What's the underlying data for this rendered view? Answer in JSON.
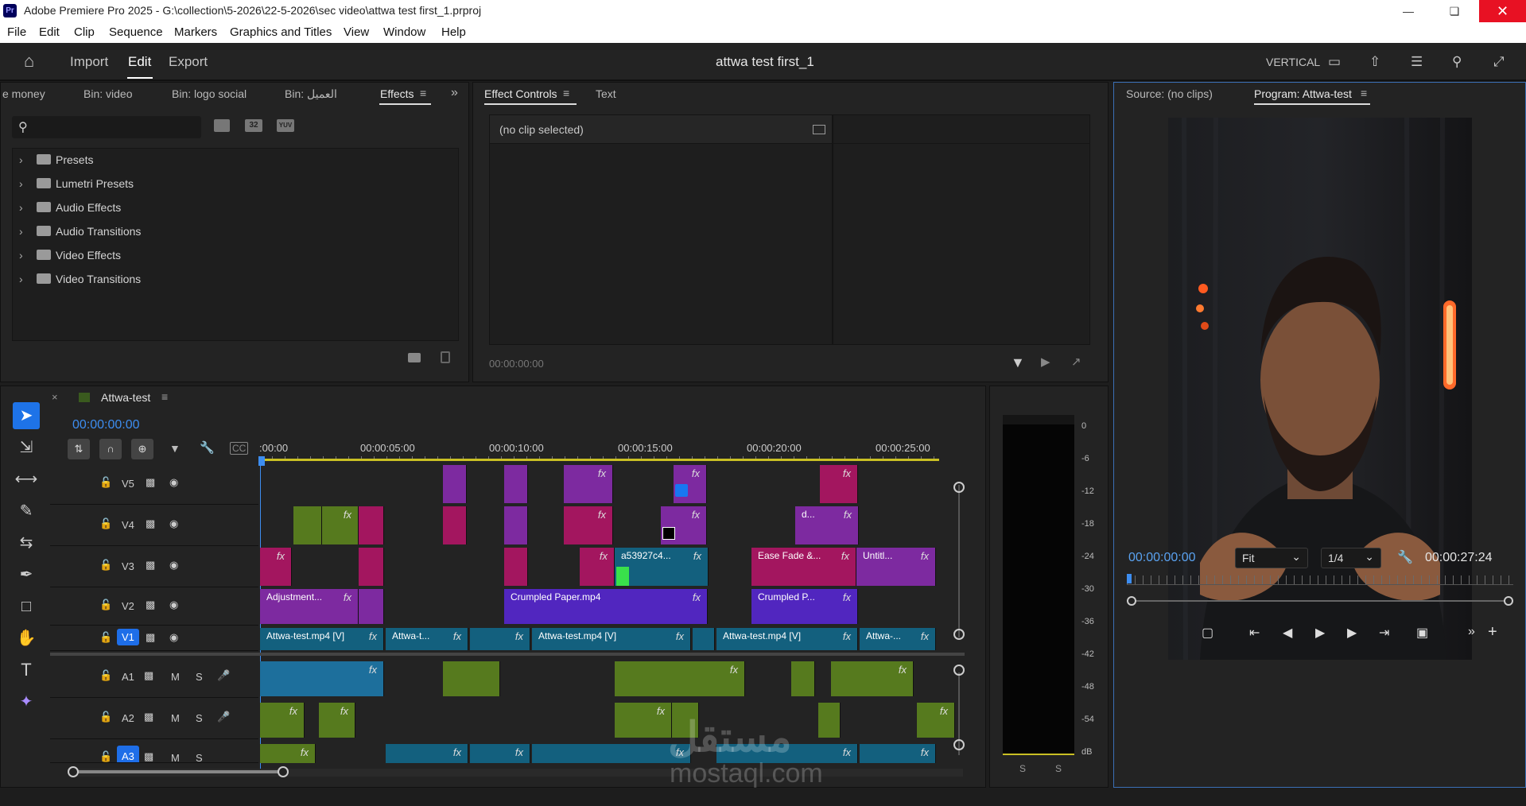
{
  "window": {
    "app_icon": "Pr",
    "title": "Adobe Premiere Pro 2025 - G:\\collection\\5-2026\\22-5-2026\\sec video\\attwa test first_1.prproj"
  },
  "menu": [
    "File",
    "Edit",
    "Clip",
    "Sequence",
    "Markers",
    "Graphics and Titles",
    "View",
    "Window",
    "Help"
  ],
  "workspace": {
    "tabs": [
      "Import",
      "Edit",
      "Export"
    ],
    "active": "Edit",
    "project_title": "attwa test first_1",
    "layout": "VERTICAL"
  },
  "effects_panel": {
    "tabs": [
      "e money",
      "Bin: video",
      "Bin: logo social",
      "Bin: العميل",
      "Effects"
    ],
    "active_tab": "Effects",
    "search_placeholder": "",
    "filter_badges": [
      "32",
      "YUV"
    ],
    "tree": [
      "Presets",
      "Lumetri Presets",
      "Audio Effects",
      "Audio Transitions",
      "Video Effects",
      "Video Transitions"
    ]
  },
  "effect_controls": {
    "tabs": [
      "Effect Controls",
      "Text"
    ],
    "message": "(no clip selected)",
    "timecode": "00:00:00:00"
  },
  "program_monitor": {
    "tabs": [
      "Source: (no clips)",
      "Program: Attwa-test"
    ],
    "timecode": "00:00:00:00",
    "fit": "Fit",
    "resolution": "1/4",
    "duration": "00:00:27:24"
  },
  "timeline": {
    "sequence": "Attwa-test",
    "timecode": "00:00:00:00",
    "ruler": [
      ":00:00",
      "00:00:05:00",
      "00:00:10:00",
      "00:00:15:00",
      "00:00:20:00",
      "00:00:25:00"
    ],
    "video_tracks": [
      "V5",
      "V4",
      "V3",
      "V2",
      "V1"
    ],
    "audio_tracks": [
      "A1",
      "A2",
      "A3"
    ],
    "audio_buttons": {
      "mute": "M",
      "solo": "S"
    },
    "clip_labels": {
      "v3_teal": "a53927c4...",
      "v3_ease": "Ease Fade &...",
      "v3_untitled": "Untitl...",
      "v2_adj": "Adjustment...",
      "v2_crumpled1": "Crumpled Paper.mp4",
      "v2_crumpled2": "Crumpled P...",
      "v1_a": "Attwa-test.mp4 [V]",
      "v1_b": "Attwa-t...",
      "v1_c": "Attwa-test.mp4 [V]",
      "v1_d": "Attwa-test.mp4 [V]",
      "v1_e": "Attwa-...",
      "v4_d": "d..."
    },
    "fx_label": "fx"
  },
  "meter": {
    "scale": [
      "0",
      "-6",
      "-12",
      "-18",
      "-24",
      "-30",
      "-36",
      "-42",
      "-48",
      "-54",
      "dB"
    ],
    "solo": [
      "S",
      "S"
    ]
  },
  "watermark": {
    "arabic": "مستقل",
    "latin": "mostaql.com"
  }
}
